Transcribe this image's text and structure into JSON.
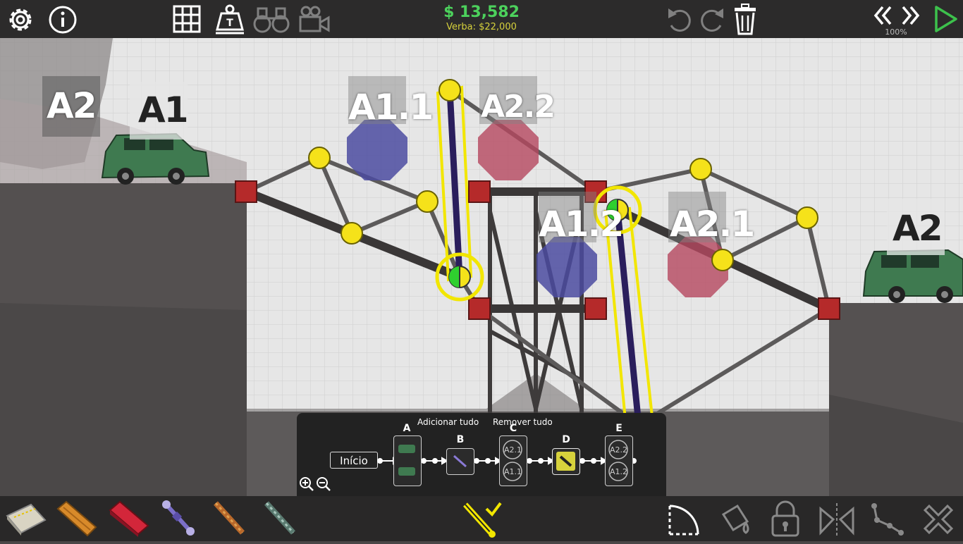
{
  "budget": {
    "money": "$ 13,582",
    "verba": "Verba: $22,000"
  },
  "speed": {
    "percent": "100%"
  },
  "labels": {
    "left_a2": "A2",
    "left_a1": "A1",
    "a1_1": "A1.1",
    "a2_2": "A2.2",
    "a1_2": "A1.2",
    "a2_1": "A2.1",
    "right_a2": "A2"
  },
  "timeline": {
    "start": "Início",
    "add_all": "Adicionar tudo",
    "remove_all": "Remover tudo",
    "steps": [
      "A",
      "B",
      "C",
      "D",
      "E"
    ],
    "step_c_items": [
      "A2.1",
      "A1.1"
    ],
    "step_e_items": [
      "A2.2",
      "A1.2"
    ]
  },
  "colors": {
    "money": "#4cd15c",
    "verba": "#d7d23c",
    "joint": "#f5e21a",
    "anchor": "#b52a2a",
    "hydraulic": "#2a1e5c",
    "selection": "#f2e600",
    "blue_checkpoint": "#4b4ba0",
    "red_checkpoint": "#b5475f",
    "car": "#3f7a50",
    "play": "#3dc14c"
  },
  "icons": {
    "top_left": [
      "settings-gear-icon",
      "info-icon"
    ],
    "top_tools": [
      "grid-icon",
      "weight-icon",
      "binoculars-icon",
      "camera-icon"
    ],
    "top_edit": [
      "undo-icon",
      "redo-icon",
      "trash-icon"
    ],
    "top_right": [
      "rewind-icon",
      "fast-forward-icon",
      "play-icon"
    ],
    "materials": [
      "road-material-icon",
      "wood-material-icon",
      "steel-material-icon",
      "hydraulic-material-icon",
      "rope-material-icon",
      "cable-material-icon"
    ],
    "bottom_right": [
      "arc-tool-icon",
      "paint-icon",
      "lock-icon",
      "mirror-icon",
      "path-icon",
      "delete-icon"
    ]
  }
}
